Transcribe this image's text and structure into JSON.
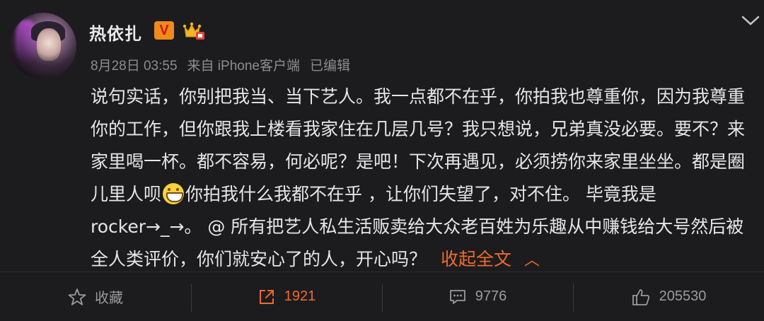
{
  "post": {
    "username": "热依扎",
    "verified_badge": "V",
    "meta": {
      "date": "8月28日 03:55",
      "source": "来自 iPhone客户端",
      "edited": "已编辑"
    },
    "content": {
      "text_before_emoji": "说句实话，你别把我当、当下艺人。我一点都不在乎，你拍我也尊重你，因为我尊重你的工作，但你跟我上楼看我家住在几层几号？我只想说，兄弟真没必要。要不？来家里喝一杯。都不容易，何必呢？是吧！下次再遇见，必须捞你来家里坐坐。都是圈儿里人呗",
      "text_after_emoji": "你拍我什么我都不在乎 ，让你们失望了，对不住。 毕竟我是rocker→_→。 @ 所有把艺人私生活贩卖给大众老百姓为乐趣从中赚钱给大号然后被全人类评价，你们就安心了的人，开心吗？",
      "collapse_label": "收起全文",
      "collapse_chevron": "^"
    }
  },
  "actions": {
    "favorite_label": "收藏",
    "repost_count": "1921",
    "comment_count": "9776",
    "like_count": "205530"
  },
  "colors": {
    "background": "#1c1c1e",
    "accent": "#ef6a2e",
    "muted": "#8d8d8d",
    "vbadge": "#ef8a1b"
  },
  "icons": {
    "menu": "chevron-down-icon",
    "emoji": "grin-icon",
    "favorite": "star-icon",
    "repost": "share-arrow-icon",
    "comment": "comment-icon",
    "like": "thumbs-up-icon"
  }
}
